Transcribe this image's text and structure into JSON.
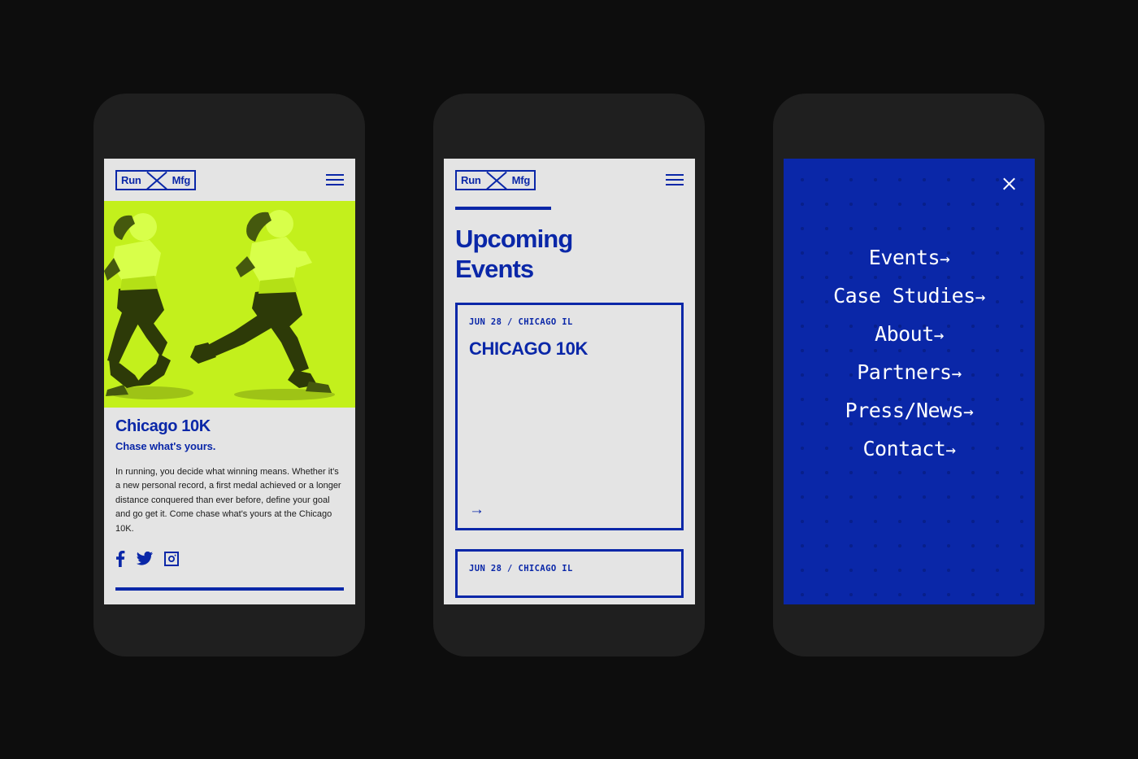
{
  "theme": {
    "blue": "#0a27a8",
    "lime": "#c3f01c",
    "screen_bg": "#e4e4e4",
    "frame": "#1f1f1f",
    "page_bg": "#0d0d0d",
    "white": "#ffffff"
  },
  "brand": {
    "word_left": "Run",
    "word_right": "Mfg"
  },
  "phone1": {
    "header": {
      "menu_icon": "hamburger-icon"
    },
    "hero": {
      "alt": "two-runners-duotone-lime"
    },
    "event_title": "Chicago 10K",
    "tagline": "Chase what's yours.",
    "body": "In running, you decide what winning means. Whether it's a new personal record, a first medal achieved or a longer distance conquered than ever before, define your goal and go get it. Come chase what's yours at the Chicago 10K.",
    "socials": [
      {
        "name": "facebook-icon",
        "label": "Facebook"
      },
      {
        "name": "twitter-icon",
        "label": "Twitter"
      },
      {
        "name": "instagram-icon",
        "label": "Instagram"
      }
    ]
  },
  "phone2": {
    "header": {
      "menu_icon": "hamburger-icon"
    },
    "page_title_line1": "Upcoming",
    "page_title_line2": "Events",
    "cards": [
      {
        "meta": "JUN 28 / CHICAGO IL",
        "name": "CHICAGO 10K",
        "arrow": "→"
      },
      {
        "meta": "JUN 28 / CHICAGO IL",
        "name": "",
        "arrow": "→"
      }
    ]
  },
  "phone3": {
    "close_label": "Close menu",
    "menu_items": [
      {
        "label": "Events",
        "arrow": "→"
      },
      {
        "label": "Case Studies",
        "arrow": "→"
      },
      {
        "label": "About",
        "arrow": "→"
      },
      {
        "label": "Partners",
        "arrow": "→"
      },
      {
        "label": "Press/News",
        "arrow": "→"
      },
      {
        "label": "Contact",
        "arrow": "→"
      }
    ]
  }
}
